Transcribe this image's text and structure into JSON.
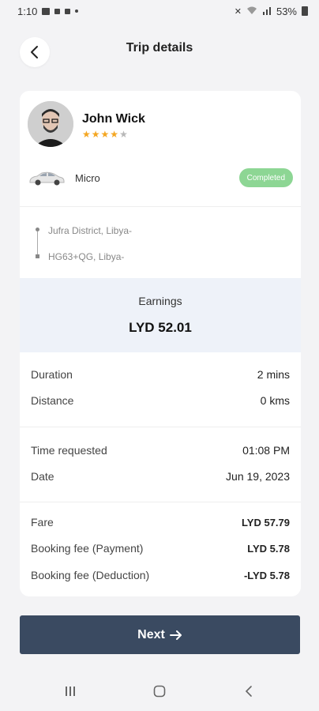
{
  "status_bar": {
    "time": "1:10",
    "battery_percent": "53%"
  },
  "header": {
    "title": "Trip details"
  },
  "driver": {
    "name": "John Wick",
    "rating": 4,
    "rating_max": 5
  },
  "vehicle": {
    "name": "Micro",
    "status": "Completed"
  },
  "route": {
    "pickup": "Jufra District, Libya-",
    "dropoff": "HG63+QG, Libya-"
  },
  "earnings": {
    "label": "Earnings",
    "value": "LYD 52.01"
  },
  "trip_stats": [
    {
      "label": "Duration",
      "value": "2 mins"
    },
    {
      "label": "Distance",
      "value": "0 kms"
    }
  ],
  "trip_time": [
    {
      "label": "Time requested",
      "value": "01:08 PM"
    },
    {
      "label": "Date",
      "value": "Jun 19, 2023"
    }
  ],
  "fare_breakdown": [
    {
      "label": "Fare",
      "value": "LYD 57.79"
    },
    {
      "label": "Booking fee (Payment)",
      "value": "LYD 5.78"
    },
    {
      "label": "Booking fee (Deduction)",
      "value": "-LYD 5.78"
    }
  ],
  "actions": {
    "next_label": "Next"
  },
  "colors": {
    "primary": "#3a4a61",
    "status_completed": "#8dd694",
    "star": "#f4a621",
    "earnings_bg": "#eef2f9"
  }
}
